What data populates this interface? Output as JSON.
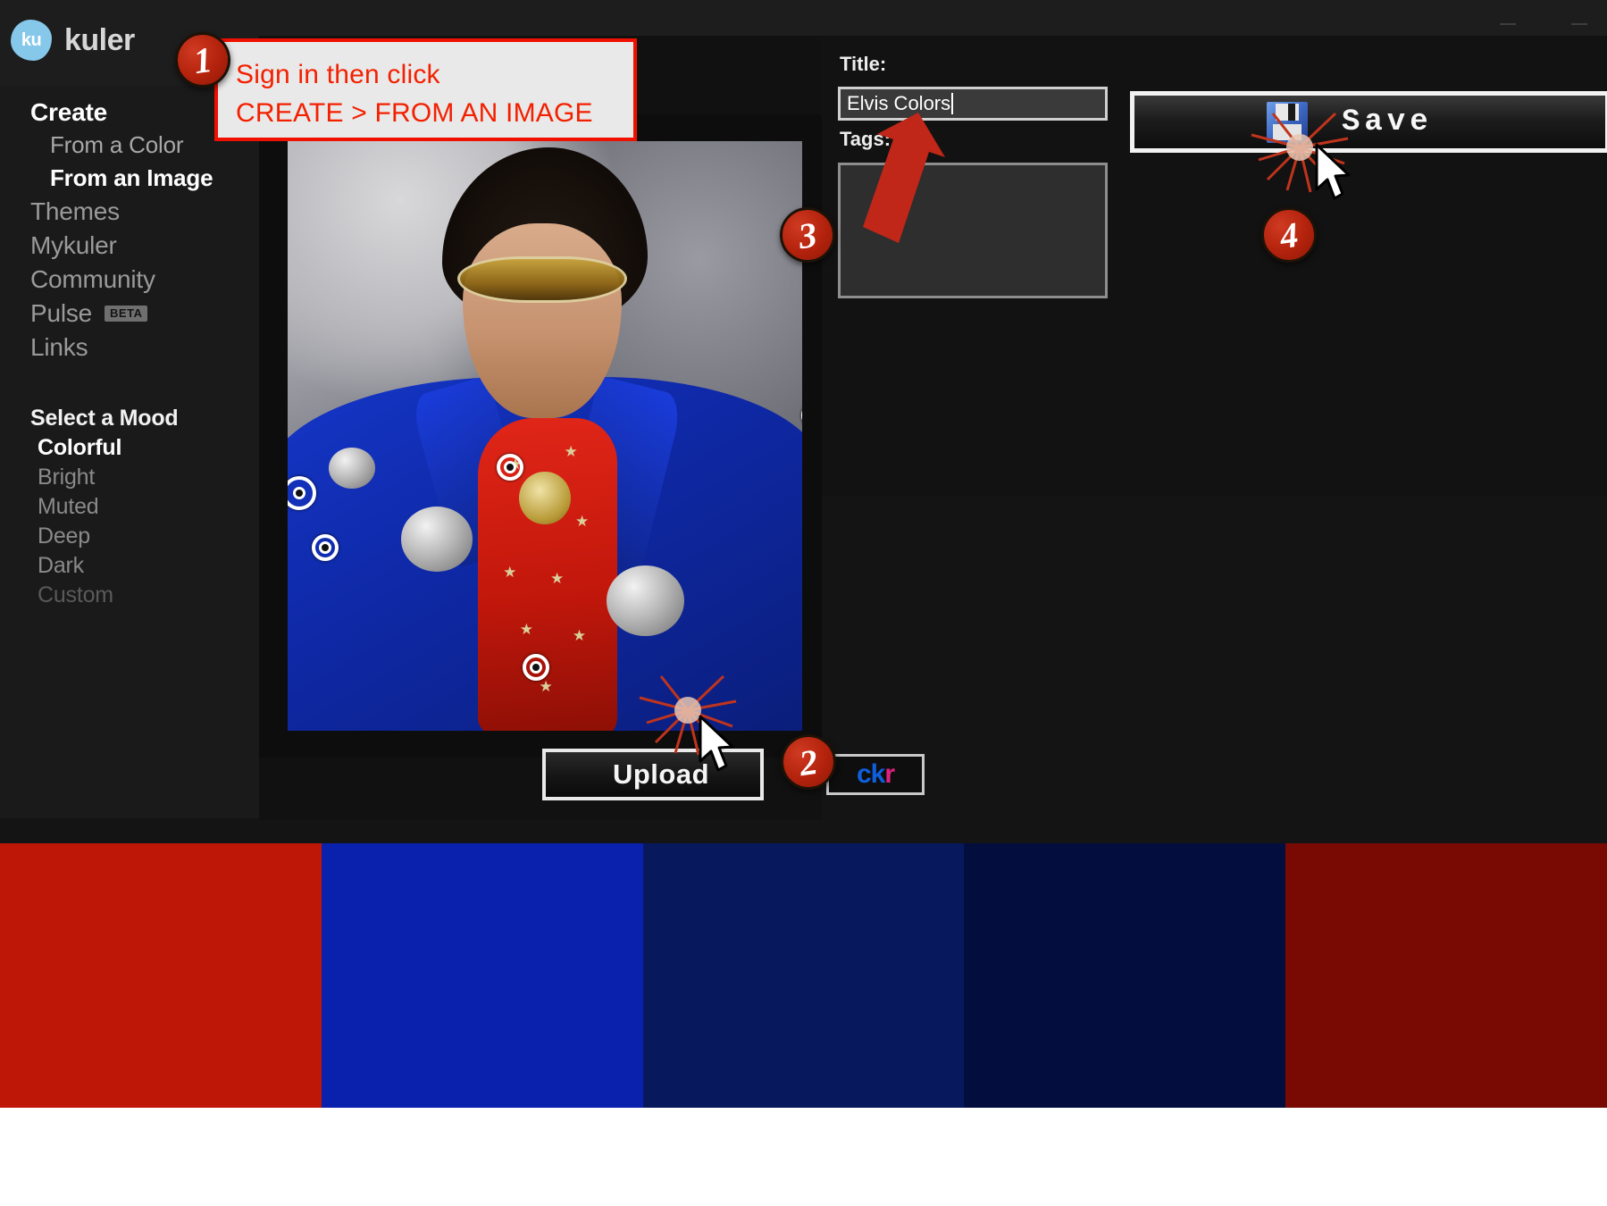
{
  "app": {
    "brand_mark": "ku",
    "brand_name": "kuler",
    "logo_color": "#86c8ea"
  },
  "sidebar": {
    "create_heading": "Create",
    "create_children": [
      {
        "label": "From a Color",
        "active": false
      },
      {
        "label": "From an Image",
        "active": true
      }
    ],
    "nav_items": [
      {
        "label": "Themes",
        "badge": ""
      },
      {
        "label": "Mykuler",
        "badge": ""
      },
      {
        "label": "Community",
        "badge": ""
      },
      {
        "label": "Pulse",
        "badge": "BETA"
      },
      {
        "label": "Links",
        "badge": ""
      }
    ],
    "mood_heading": "Select a Mood",
    "moods": [
      {
        "label": "Colorful",
        "state": "active"
      },
      {
        "label": "Bright",
        "state": "normal"
      },
      {
        "label": "Muted",
        "state": "normal"
      },
      {
        "label": "Deep",
        "state": "normal"
      },
      {
        "label": "Dark",
        "state": "normal"
      },
      {
        "label": "Custom",
        "state": "dim"
      }
    ]
  },
  "editor": {
    "upload_label": "Upload",
    "upload_icon": "green-up-arrow-icon",
    "flickr_label_blue": "ck",
    "flickr_label_pink": "r",
    "sample_markers": 5
  },
  "details": {
    "title_label": "Title:",
    "title_value": "Elvis Colors",
    "tags_label": "Tags:",
    "tags_value": "",
    "save_label": "Save",
    "save_icon": "floppy-disk-icon"
  },
  "swatches": [
    {
      "hex": "#BF1707"
    },
    {
      "hex": "#0A21AE"
    },
    {
      "hex": "#07195C"
    },
    {
      "hex": "#040E3E"
    },
    {
      "hex": "#780A03"
    }
  ],
  "annotations": {
    "callout_line1": "Sign in then click",
    "callout_line2": "CREATE > FROM AN IMAGE",
    "callout_border_color": "#F01000",
    "callout_text_color": "#F32000",
    "badges": [
      {
        "number": "1"
      },
      {
        "number": "2"
      },
      {
        "number": "3"
      },
      {
        "number": "4"
      }
    ]
  }
}
